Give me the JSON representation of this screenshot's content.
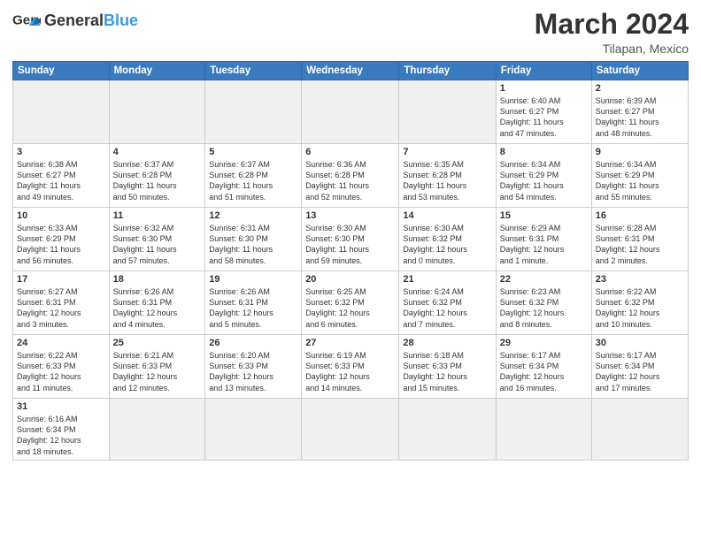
{
  "header": {
    "logo_general": "General",
    "logo_blue": "Blue",
    "month_title": "March 2024",
    "subtitle": "Tilapan, Mexico"
  },
  "days_of_week": [
    "Sunday",
    "Monday",
    "Tuesday",
    "Wednesday",
    "Thursday",
    "Friday",
    "Saturday"
  ],
  "weeks": [
    [
      {
        "day": "",
        "info": ""
      },
      {
        "day": "",
        "info": ""
      },
      {
        "day": "",
        "info": ""
      },
      {
        "day": "",
        "info": ""
      },
      {
        "day": "",
        "info": ""
      },
      {
        "day": "1",
        "info": "Sunrise: 6:40 AM\nSunset: 6:27 PM\nDaylight: 11 hours\nand 47 minutes."
      },
      {
        "day": "2",
        "info": "Sunrise: 6:39 AM\nSunset: 6:27 PM\nDaylight: 11 hours\nand 48 minutes."
      }
    ],
    [
      {
        "day": "3",
        "info": "Sunrise: 6:38 AM\nSunset: 6:27 PM\nDaylight: 11 hours\nand 49 minutes."
      },
      {
        "day": "4",
        "info": "Sunrise: 6:37 AM\nSunset: 6:28 PM\nDaylight: 11 hours\nand 50 minutes."
      },
      {
        "day": "5",
        "info": "Sunrise: 6:37 AM\nSunset: 6:28 PM\nDaylight: 11 hours\nand 51 minutes."
      },
      {
        "day": "6",
        "info": "Sunrise: 6:36 AM\nSunset: 6:28 PM\nDaylight: 11 hours\nand 52 minutes."
      },
      {
        "day": "7",
        "info": "Sunrise: 6:35 AM\nSunset: 6:28 PM\nDaylight: 11 hours\nand 53 minutes."
      },
      {
        "day": "8",
        "info": "Sunrise: 6:34 AM\nSunset: 6:29 PM\nDaylight: 11 hours\nand 54 minutes."
      },
      {
        "day": "9",
        "info": "Sunrise: 6:34 AM\nSunset: 6:29 PM\nDaylight: 11 hours\nand 55 minutes."
      }
    ],
    [
      {
        "day": "10",
        "info": "Sunrise: 6:33 AM\nSunset: 6:29 PM\nDaylight: 11 hours\nand 56 minutes."
      },
      {
        "day": "11",
        "info": "Sunrise: 6:32 AM\nSunset: 6:30 PM\nDaylight: 11 hours\nand 57 minutes."
      },
      {
        "day": "12",
        "info": "Sunrise: 6:31 AM\nSunset: 6:30 PM\nDaylight: 11 hours\nand 58 minutes."
      },
      {
        "day": "13",
        "info": "Sunrise: 6:30 AM\nSunset: 6:30 PM\nDaylight: 11 hours\nand 59 minutes."
      },
      {
        "day": "14",
        "info": "Sunrise: 6:30 AM\nSunset: 6:32 PM\nDaylight: 12 hours\nand 0 minutes."
      },
      {
        "day": "15",
        "info": "Sunrise: 6:29 AM\nSunset: 6:31 PM\nDaylight: 12 hours\nand 1 minute."
      },
      {
        "day": "16",
        "info": "Sunrise: 6:28 AM\nSunset: 6:31 PM\nDaylight: 12 hours\nand 2 minutes."
      }
    ],
    [
      {
        "day": "17",
        "info": "Sunrise: 6:27 AM\nSunset: 6:31 PM\nDaylight: 12 hours\nand 3 minutes."
      },
      {
        "day": "18",
        "info": "Sunrise: 6:26 AM\nSunset: 6:31 PM\nDaylight: 12 hours\nand 4 minutes."
      },
      {
        "day": "19",
        "info": "Sunrise: 6:26 AM\nSunset: 6:31 PM\nDaylight: 12 hours\nand 5 minutes."
      },
      {
        "day": "20",
        "info": "Sunrise: 6:25 AM\nSunset: 6:32 PM\nDaylight: 12 hours\nand 6 minutes."
      },
      {
        "day": "21",
        "info": "Sunrise: 6:24 AM\nSunset: 6:32 PM\nDaylight: 12 hours\nand 7 minutes."
      },
      {
        "day": "22",
        "info": "Sunrise: 6:23 AM\nSunset: 6:32 PM\nDaylight: 12 hours\nand 8 minutes."
      },
      {
        "day": "23",
        "info": "Sunrise: 6:22 AM\nSunset: 6:32 PM\nDaylight: 12 hours\nand 10 minutes."
      }
    ],
    [
      {
        "day": "24",
        "info": "Sunrise: 6:22 AM\nSunset: 6:33 PM\nDaylight: 12 hours\nand 11 minutes."
      },
      {
        "day": "25",
        "info": "Sunrise: 6:21 AM\nSunset: 6:33 PM\nDaylight: 12 hours\nand 12 minutes."
      },
      {
        "day": "26",
        "info": "Sunrise: 6:20 AM\nSunset: 6:33 PM\nDaylight: 12 hours\nand 13 minutes."
      },
      {
        "day": "27",
        "info": "Sunrise: 6:19 AM\nSunset: 6:33 PM\nDaylight: 12 hours\nand 14 minutes."
      },
      {
        "day": "28",
        "info": "Sunrise: 6:18 AM\nSunset: 6:33 PM\nDaylight: 12 hours\nand 15 minutes."
      },
      {
        "day": "29",
        "info": "Sunrise: 6:17 AM\nSunset: 6:34 PM\nDaylight: 12 hours\nand 16 minutes."
      },
      {
        "day": "30",
        "info": "Sunrise: 6:17 AM\nSunset: 6:34 PM\nDaylight: 12 hours\nand 17 minutes."
      }
    ],
    [
      {
        "day": "31",
        "info": "Sunrise: 6:16 AM\nSunset: 6:34 PM\nDaylight: 12 hours\nand 18 minutes."
      },
      {
        "day": "",
        "info": ""
      },
      {
        "day": "",
        "info": ""
      },
      {
        "day": "",
        "info": ""
      },
      {
        "day": "",
        "info": ""
      },
      {
        "day": "",
        "info": ""
      },
      {
        "day": "",
        "info": ""
      }
    ]
  ]
}
